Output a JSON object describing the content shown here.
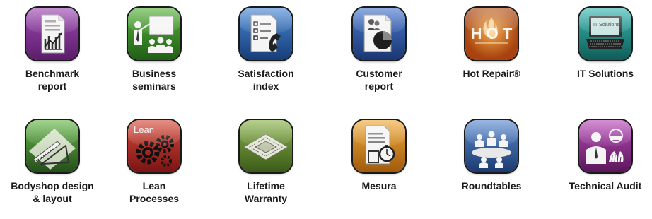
{
  "tiles": [
    {
      "line1": "Benchmark",
      "line2": "report",
      "icon": "benchmark-report-icon",
      "color": "#7b2f8c"
    },
    {
      "line1": "Business",
      "line2": "seminars",
      "icon": "business-seminars-icon",
      "color": "#3a8a2a"
    },
    {
      "line1": "Satisfaction",
      "line2": "index",
      "icon": "satisfaction-index-icon",
      "color": "#2a67b0"
    },
    {
      "line1": "Customer",
      "line2": "report",
      "icon": "customer-report-icon",
      "color": "#2a57a8"
    },
    {
      "line1": "Hot Repair®",
      "line2": "",
      "icon": "hot-repair-icon",
      "color": "#c9631a"
    },
    {
      "line1": "IT Solutions",
      "line2": "",
      "icon": "it-solutions-icon",
      "color": "#1a8a86",
      "screen_text": "IT Solutions"
    },
    {
      "line1": "Bodyshop design",
      "line2": "& layout",
      "icon": "bodyshop-design-icon",
      "color": "#3f8a2a"
    },
    {
      "line1": "Lean",
      "line2": "Processes",
      "icon": "lean-processes-icon",
      "color": "#b8282a",
      "icon_text": "Lean"
    },
    {
      "line1": "Lifetime",
      "line2": "Warranty",
      "icon": "lifetime-warranty-icon",
      "color": "#6a8a2a"
    },
    {
      "line1": "Mesura",
      "line2": "",
      "icon": "mesura-icon",
      "color": "#d9891a"
    },
    {
      "line1": "Roundtables",
      "line2": "",
      "icon": "roundtables-icon",
      "color": "#3a6aa8"
    },
    {
      "line1": "Technical Audit",
      "line2": "",
      "icon": "technical-audit-icon",
      "color": "#8a2a8a"
    }
  ]
}
